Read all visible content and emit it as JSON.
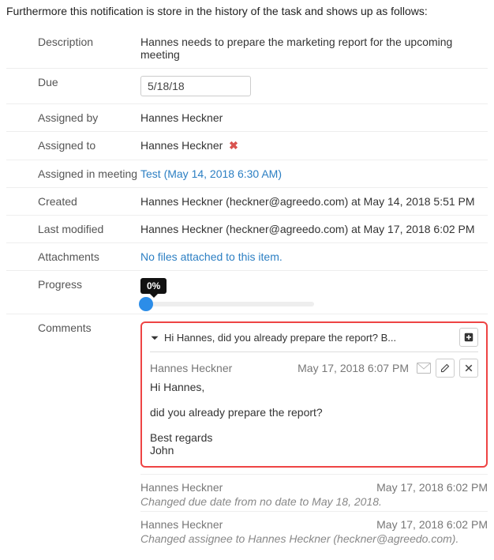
{
  "intro": "Furthermore this notification is store in the history of the task and shows up as follows:",
  "labels": {
    "description": "Description",
    "due": "Due",
    "assigned_by": "Assigned by",
    "assigned_to": "Assigned to",
    "assigned_in_meeting": "Assigned in meeting",
    "created": "Created",
    "last_modified": "Last modified",
    "attachments": "Attachments",
    "progress": "Progress",
    "comments": "Comments"
  },
  "values": {
    "description": "Hannes needs to prepare the marketing report for the upcoming meeting",
    "due": "5/18/18",
    "assigned_by": "Hannes Heckner",
    "assigned_to": "Hannes Heckner",
    "assigned_in_meeting": "Test (May 14, 2018 6:30 AM)",
    "created": "Hannes Heckner (heckner@agreedo.com) at May 14, 2018 5:51 PM",
    "last_modified": "Hannes Heckner (heckner@agreedo.com) at May 17, 2018 6:02 PM",
    "attachments": "No files attached to this item.",
    "progress_pct": "0%"
  },
  "comments": {
    "summary": "Hi Hannes, did you already prepare the report? B...",
    "entry": {
      "author": "Hannes Heckner",
      "timestamp": "May 17, 2018 6:07 PM",
      "body": "Hi Hannes,\n\ndid you already prepare the report?\n\nBest regards\nJohn"
    }
  },
  "history": [
    {
      "author": "Hannes Heckner",
      "timestamp": "May 17, 2018 6:02 PM",
      "desc": "Changed due date from no date to May 18, 2018."
    },
    {
      "author": "Hannes Heckner",
      "timestamp": "May 17, 2018 6:02 PM",
      "desc": "Changed assignee to Hannes Heckner (heckner@agreedo.com)."
    }
  ]
}
